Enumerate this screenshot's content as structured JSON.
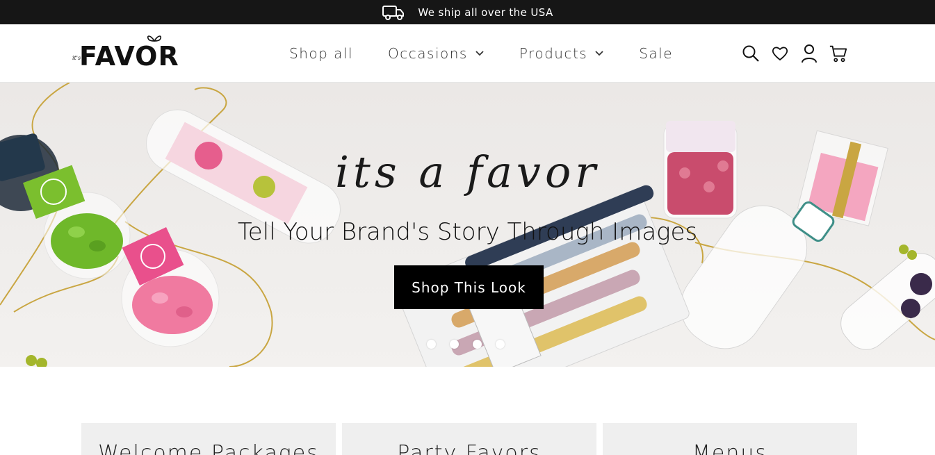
{
  "announcement": {
    "text": "We ship all over the USA",
    "icon": "truck-icon"
  },
  "header": {
    "logo_small": "it's a",
    "logo_text": "FAVOR",
    "nav": [
      {
        "label": "Shop all",
        "has_dropdown": false
      },
      {
        "label": "Occasions",
        "has_dropdown": true
      },
      {
        "label": "Products",
        "has_dropdown": true
      },
      {
        "label": "Sale",
        "has_dropdown": false
      }
    ],
    "icons": [
      "search-icon",
      "heart-icon",
      "account-icon",
      "cart-icon"
    ]
  },
  "hero": {
    "script_text": "its a favor",
    "heading": "Tell Your Brand's Story Through Images",
    "button_label": "Shop This Look",
    "slides_count": 4,
    "active_slide": 1
  },
  "categories": [
    {
      "title": "Welcome Packages"
    },
    {
      "title": "Party Favors"
    },
    {
      "title": "Menus"
    }
  ],
  "colors": {
    "announcement_bg": "#161616",
    "button_bg": "#000000",
    "accent_pink": "#e9508c",
    "accent_green": "#7bbf2e",
    "gold": "#c9a642"
  }
}
